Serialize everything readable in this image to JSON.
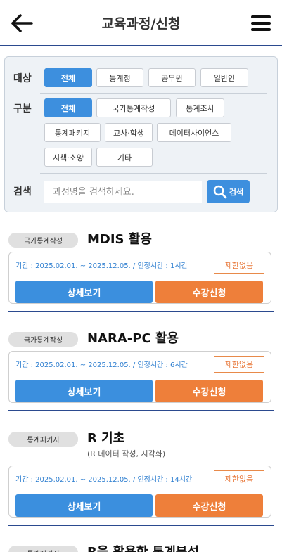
{
  "header": {
    "title": "교육과정/신청",
    "back_icon": "arrow-left-icon",
    "menu_icon": "hamburger-menu-icon"
  },
  "filter": {
    "target_label": "대상",
    "target_options": [
      "전체",
      "통계청",
      "공무원",
      "일반인"
    ],
    "type_label": "구분",
    "type_options": [
      "전체",
      "국가통계작성",
      "통계조사",
      "통계패키지",
      "교사·학생",
      "데이터사이언스",
      "시책·소양",
      "기타"
    ],
    "search_label": "검색",
    "search_placeholder": "과정명을 검색하세요.",
    "search_button": "검색",
    "accent_color": "#3d8fde"
  },
  "courses": [
    {
      "category": "국가통계작성",
      "title": "MDIS 활용",
      "subtitle": "",
      "period": "기간 : 2025.02.01. ~ 2025.12.05. / 인정시간 : 1시간",
      "limit": "제한없음",
      "detail": "상세보기",
      "apply": "수강신청"
    },
    {
      "category": "국가통계작성",
      "title": "NARA-PC 활용",
      "subtitle": "",
      "period": "기간 : 2025.02.01. ~ 2025.12.05. / 인정시간 : 6시간",
      "limit": "제한없음",
      "detail": "상세보기",
      "apply": "수강신청"
    },
    {
      "category": "통계패키지",
      "title": "R 기초",
      "subtitle": "(R 데이터 작성, 시각화)",
      "period": "기간 : 2025.02.01. ~ 2025.12.05. / 인정시간 : 14시간",
      "limit": "제한없음",
      "detail": "상세보기",
      "apply": "수강신청"
    },
    {
      "category": "통계패키지",
      "title": "R을 활용한 통계분석"
    }
  ]
}
